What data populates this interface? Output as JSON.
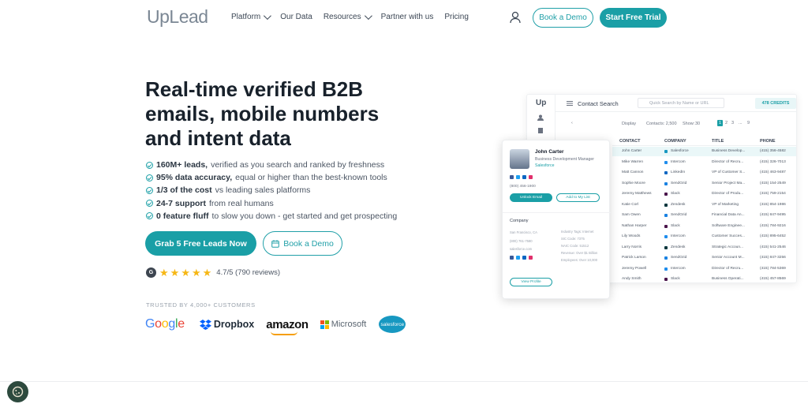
{
  "nav": {
    "logo": "UpLead",
    "menu": [
      {
        "label": "Platform",
        "dropdown": true
      },
      {
        "label": "Our Data",
        "dropdown": false
      },
      {
        "label": "Resources",
        "dropdown": true
      },
      {
        "label": "Partner with us",
        "dropdown": false
      },
      {
        "label": "Pricing",
        "dropdown": false
      }
    ],
    "book_demo": "Book a Demo",
    "start_trial": "Start Free Trial"
  },
  "hero": {
    "headline": "Real-time verified B2B emails, mobile numbers and intent data",
    "bullets": [
      {
        "strong": "160M+ leads,",
        "rest": " verified as you search and ranked by freshness"
      },
      {
        "strong": "95% data accuracy,",
        "rest": " equal or higher than the best-known tools"
      },
      {
        "strong": "1/3 of the cost",
        "rest": " vs leading sales platforms"
      },
      {
        "strong": "24-7 support",
        "rest": " from real humans"
      },
      {
        "strong": "0 feature fluff",
        "rest": " to slow you down - get started and get prospecting"
      }
    ],
    "cta_primary": "Grab 5 Free Leads Now",
    "cta_secondary": "Book a Demo",
    "rating_text": "4.7/5 (790 reviews)",
    "stars": 5,
    "trusted": "TRUSTED BY 4,000+ CUSTOMERS",
    "logos": [
      "Google",
      "Dropbox",
      "amazon",
      "Microsoft",
      "salesforce"
    ]
  },
  "app": {
    "logo": "Up",
    "title": "Contact Search",
    "search_placeholder": "Quick Search by Name or URL",
    "credits": "478 CREDITS",
    "display_label": "Display",
    "contacts_label": "Contacts: 2,500",
    "show_label": "Show:",
    "show_value": "30",
    "pages": [
      "1",
      "2",
      "3",
      "...",
      "9"
    ],
    "columns": [
      "CONTACT",
      "COMPANY",
      "TITLE",
      "PHONE"
    ],
    "rows": [
      [
        "John Carter",
        "Salesforce",
        "Business Develop...",
        "(415) 356-4582"
      ],
      [
        "Mike Warren",
        "Intercom",
        "Director of Recru...",
        "(415) 326-7013"
      ],
      [
        "Matt Cannon",
        "LinkedIn",
        "VP of Customer S...",
        "(415) 463-9487"
      ],
      [
        "Sophie Moore",
        "SendGrid",
        "Senior Project Ma...",
        "(415) 154-2549"
      ],
      [
        "Jeremy Matthews",
        "Slack",
        "Director of Produ...",
        "(415) 759-2154"
      ],
      [
        "Katie Corl",
        "Zendesk",
        "VP of Marketing",
        "(415) 854-1986"
      ],
      [
        "Sam Owen",
        "SendGrid",
        "Financial Data An...",
        "(415) 847-9495"
      ],
      [
        "Nathan Harper",
        "Slack",
        "Software Enginee...",
        "(415) 784-9216"
      ],
      [
        "Lily Woods",
        "Intercom",
        "Customer Succes...",
        "(415) 895-6452"
      ],
      [
        "Larry Norris",
        "Zendesk",
        "Strategic Accoun...",
        "(415) 541-2546"
      ],
      [
        "Patrick Larson",
        "SendGrid",
        "Senior Account M...",
        "(415) 847-3256"
      ],
      [
        "Jeremy Powell",
        "Intercom",
        "Director of Recru...",
        "(415) 784-5369"
      ],
      [
        "Andy Smith",
        "Slack",
        "Business Operati...",
        "(415) 457-8569"
      ]
    ],
    "company_colors": {
      "Salesforce": "#1798c1",
      "Intercom": "#1f8ded",
      "LinkedIn": "#0a66c2",
      "SendGrid": "#1a82e2",
      "Slack": "#4a154b",
      "Zendesk": "#03363d"
    }
  },
  "card": {
    "name": "John Carter",
    "title": "Business Development Manager",
    "company": "Salesforce",
    "phone": "(800) 456-1900",
    "unlock": "Unlock Email",
    "add_list": "Add to My List",
    "company_label": "Company",
    "details_left": [
      "San Francisco, CA",
      "(800) 761-7580",
      "salesforce.com"
    ],
    "details_right": [
      "Industry Tags: Internet",
      "SIC Code: 7375",
      "NAIC Code: 51512",
      "Revenue: Over $1 Billion",
      "Employees: Over 10,000"
    ],
    "view_profile": "View Profile"
  },
  "colors": {
    "accent": "#1a9fa6",
    "text": "#18212b",
    "star": "#f6b715"
  }
}
